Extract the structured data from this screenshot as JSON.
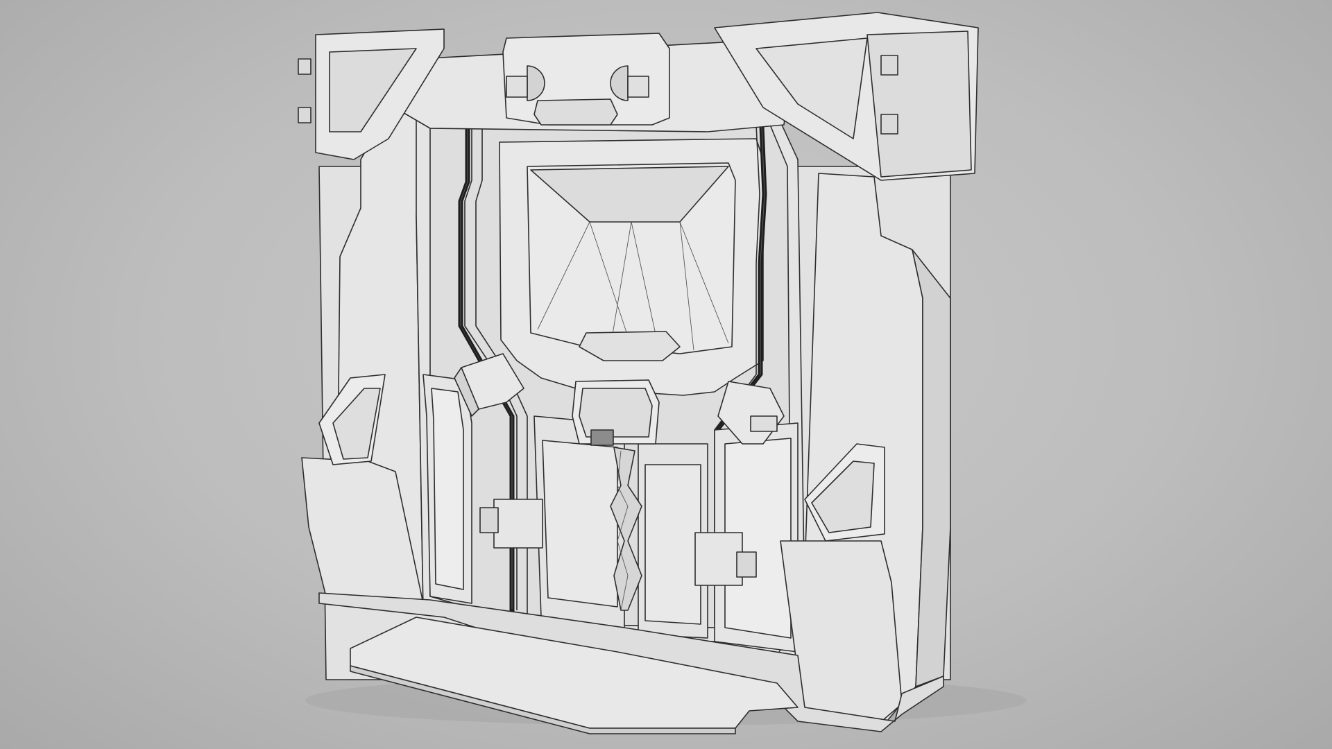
{
  "scene": {
    "subject": "sci-fi-door",
    "render_style": "wireframe-on-clay",
    "colors": {
      "background": "#bdbdbd",
      "surface": "#e9e9e9",
      "surface_shade": "#d9d9d9",
      "surface_dark": "#cfcfcf",
      "edge": "#2d2d2d",
      "wire": "#555555",
      "groove": "#5d5d5d"
    }
  }
}
